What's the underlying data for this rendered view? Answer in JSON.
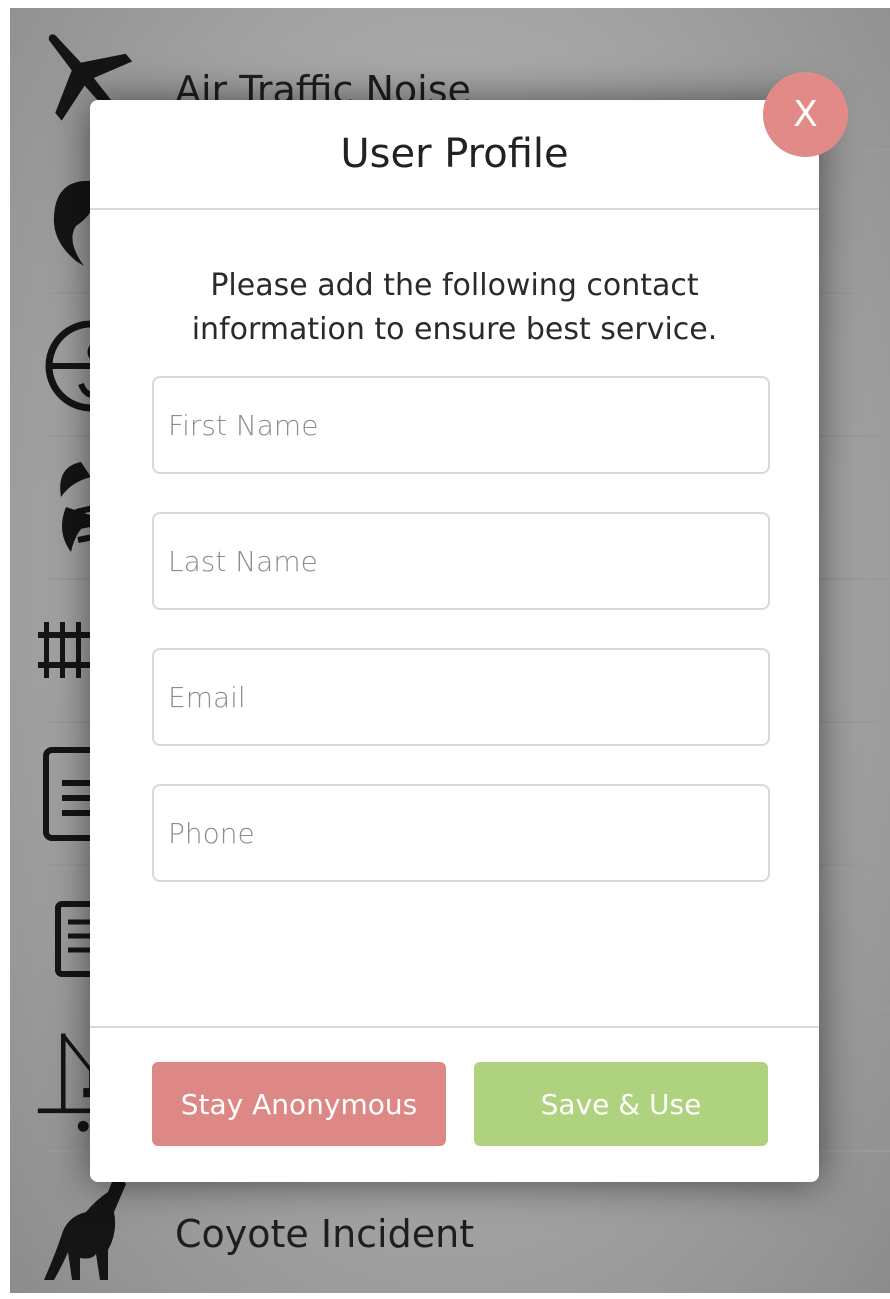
{
  "background_list": {
    "items": [
      {
        "label": "Air Traffic Noise",
        "icon": "airplane-icon"
      },
      {
        "label": "",
        "icon": "person-head-icon"
      },
      {
        "label": "",
        "icon": "gauge-icon"
      },
      {
        "label": "",
        "icon": "hornet-icon"
      },
      {
        "label": "",
        "icon": "railroad-track-icon"
      },
      {
        "label": "",
        "icon": "document-icon"
      },
      {
        "label": "",
        "icon": "certificate-icon"
      },
      {
        "label": "",
        "icon": "construction-crane-icon"
      },
      {
        "label": "Coyote Incident",
        "icon": "howling-coyote-icon"
      }
    ]
  },
  "modal": {
    "title": "User Profile",
    "close_label": "X",
    "intro": "Please add the following contact information to ensure best service.",
    "fields": {
      "first_name": {
        "placeholder": "First Name",
        "value": ""
      },
      "last_name": {
        "placeholder": "Last Name",
        "value": ""
      },
      "email": {
        "placeholder": "Email",
        "value": ""
      },
      "phone": {
        "placeholder": "Phone",
        "value": ""
      }
    },
    "buttons": {
      "anonymous": "Stay Anonymous",
      "save": "Save & Use"
    }
  },
  "colors": {
    "close_button": "#e28a88",
    "anonymous_button": "#de8886",
    "save_button": "#aed27d"
  }
}
